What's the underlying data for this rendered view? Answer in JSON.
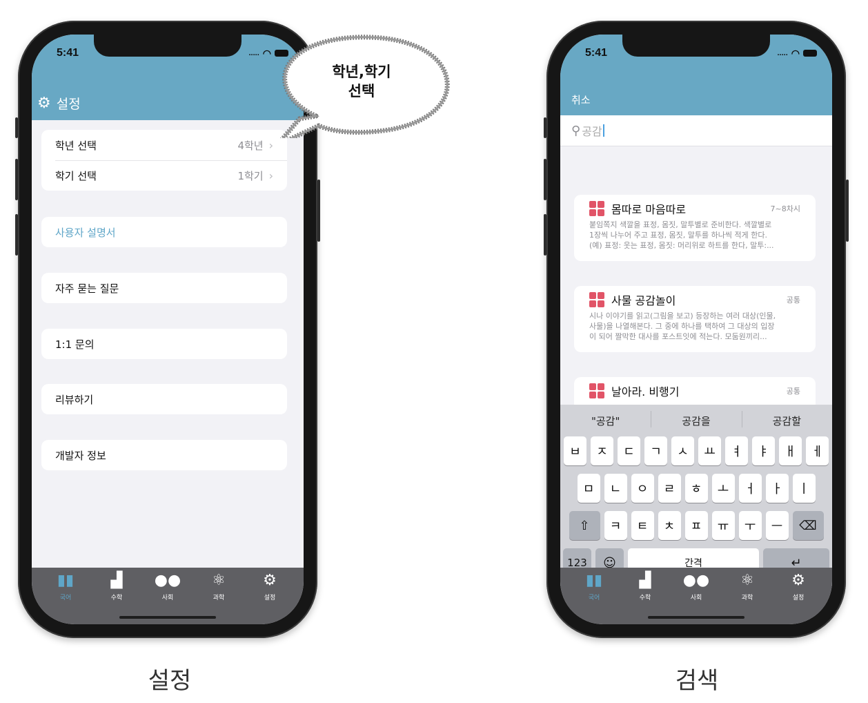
{
  "status": {
    "time": "5:41",
    "cellular": "....."
  },
  "left_phone": {
    "header_title": "설정",
    "group1": [
      {
        "label": "학년 선택",
        "value": "4학년"
      },
      {
        "label": "학기 선택",
        "value": "1학기"
      }
    ],
    "manual": "사용자 설명서",
    "faq": "자주 묻는 질문",
    "inquiry": "1:1 문의",
    "review": "리뷰하기",
    "developer": "개발자 정보",
    "caption": "설정"
  },
  "callout_text": "학년,학기\n선택",
  "tabbar": [
    {
      "label": "국어",
      "icon": "book-icon"
    },
    {
      "label": "수학",
      "icon": "bar-chart-icon"
    },
    {
      "label": "사회",
      "icon": "people-icon"
    },
    {
      "label": "과학",
      "icon": "atom-icon"
    },
    {
      "label": "설정",
      "icon": "gear-icon"
    }
  ],
  "right_phone": {
    "cancel_label": "취소",
    "search_query": "공감",
    "cards": [
      {
        "title": "몸따로 마음따로",
        "tag": "7~8차시",
        "desc": "붙임쪽지 색깔을 표정, 몸짓, 말투별로 준비한다. 색깔별로\n1장씩 나누어 주고 표정, 몸짓, 말투를 하나씩 적게 한다.\n(예) 표정: 웃는 표정, 몸짓: 머리위로 하트를 한다, 말투:..."
      },
      {
        "title": "사물 공감놀이",
        "tag": "공통",
        "desc": "시나 이야기를 읽고(그림을 보고) 등장하는 여러 대상(인물,\n사물)을 나열해본다. 그 중에 하나를 택하여 그 대상의 입장\n이 되어 짤막한 대사를 포스트잇에 적는다. 모둠원끼리..."
      },
      {
        "title": "날아라. 비행기",
        "tag": "공통",
        "desc": ""
      }
    ],
    "suggestions": [
      "\"공감\"",
      "공감을",
      "공감할"
    ],
    "keys_row1": [
      "ㅂ",
      "ㅈ",
      "ㄷ",
      "ㄱ",
      "ㅅ",
      "ㅛ",
      "ㅕ",
      "ㅑ",
      "ㅐ",
      "ㅔ"
    ],
    "keys_row2": [
      "ㅁ",
      "ㄴ",
      "ㅇ",
      "ㄹ",
      "ㅎ",
      "ㅗ",
      "ㅓ",
      "ㅏ",
      "ㅣ"
    ],
    "keys_row3": [
      "ㅋ",
      "ㅌ",
      "ㅊ",
      "ㅍ",
      "ㅠ",
      "ㅜ",
      "ㅡ"
    ],
    "key_numbers": "123",
    "key_space": "간격",
    "caption": "검색"
  },
  "colors": {
    "accent": "#68a8c4",
    "tab_bg": "#5f5f63",
    "card_icon": "#e15467"
  }
}
